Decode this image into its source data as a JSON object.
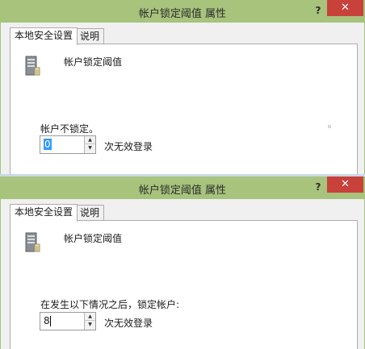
{
  "colors": {
    "titlebar": "#a7c37c",
    "close": "#c8413a",
    "selection": "#3399ff"
  },
  "panels": [
    {
      "title": "帐户锁定阈值 属性",
      "help": "?",
      "close": "✕",
      "tabs": [
        "本地安全设置",
        "说明"
      ],
      "policy_name": "帐户锁定阈值",
      "policy_icon": "server-icon",
      "status_label": "帐户不锁定。",
      "spin_value": "0",
      "suffix": "次无效登录"
    },
    {
      "title": "帐户锁定阈值 属性",
      "help": "?",
      "close": "✕",
      "tabs": [
        "本地安全设置",
        "说明"
      ],
      "policy_name": "帐户锁定阈值",
      "policy_icon": "server-icon",
      "status_label": "在发生以下情况之后，锁定帐户:",
      "spin_value": "8",
      "suffix": "次无效登录"
    }
  ]
}
